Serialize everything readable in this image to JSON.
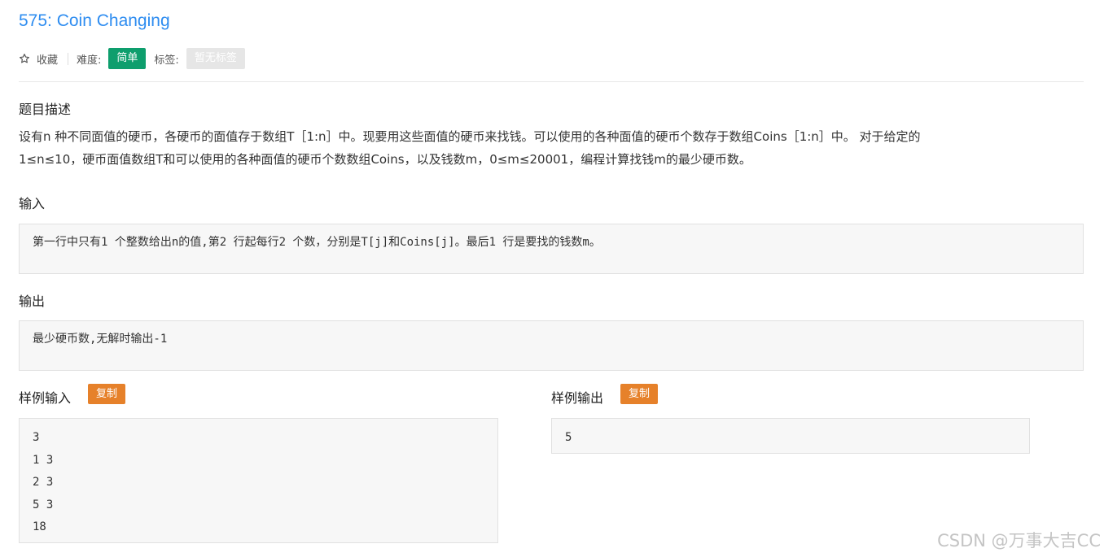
{
  "problem": {
    "title": "575: Coin Changing"
  },
  "meta": {
    "favorite_label": "收藏",
    "difficulty_label": "难度:",
    "difficulty_value": "简单",
    "tags_label": "标签:",
    "tags_value": "暂无标签"
  },
  "description": {
    "heading": "题目描述",
    "line1": "设有n 种不同面值的硬币，各硬币的面值存于数组T［1:n］中。现要用这些面值的硬币来找钱。可以使用的各种面值的硬币个数存于数组Coins［1:n］中。 对于给定的",
    "line2": "1≤n≤10，硬币面值数组T和可以使用的各种面值的硬币个数数组Coins，以及钱数m，0≤m≤20001，编程计算找钱m的最少硬币数。"
  },
  "input": {
    "heading": "输入",
    "text": "第一行中只有1 个整数给出n的值,第2 行起每行2 个数，分别是T[j]和Coins[j]。最后1 行是要找的钱数m。"
  },
  "output": {
    "heading": "输出",
    "text": "最少硬币数,无解时输出-1"
  },
  "sample_input": {
    "heading": "样例输入",
    "copy_label": "复制",
    "content": "3\n1 3\n2 3\n5 3\n18"
  },
  "sample_output": {
    "heading": "样例输出",
    "copy_label": "复制",
    "content": "5"
  },
  "watermark": "CSDN @万事大吉CC",
  "colors": {
    "title": "#2d8cf0",
    "difficulty_badge": "#0e9e6d",
    "copy_button": "#e6812a",
    "tags_badge": "#e6e6e6"
  },
  "icons": {
    "favorite": "star-outline-icon"
  }
}
